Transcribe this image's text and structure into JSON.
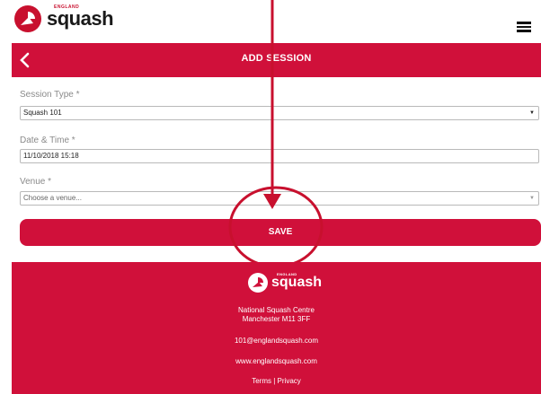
{
  "brand": {
    "small": "ENGLAND",
    "name": "squash",
    "color": "#c8102e"
  },
  "header": {
    "menu_icon": "hamburger-menu-icon",
    "back_icon": "chevron-left-icon",
    "title": "ADD SESSION"
  },
  "form": {
    "session_type": {
      "label": "Session Type *",
      "value": "Squash 101"
    },
    "date_time": {
      "label": "Date & Time *",
      "value": "11/10/2018 15:18"
    },
    "venue": {
      "label": "Venue *",
      "placeholder": "Choose a venue..."
    },
    "save_label": "SAVE"
  },
  "footer": {
    "brand_small": "ENGLAND",
    "brand_name": "squash",
    "address_line1": "National Squash Centre",
    "address_line2": "Manchester M11 3FF",
    "email": "101@englandsquash.com",
    "website": "www.englandsquash.com",
    "terms": "Terms",
    "separator": "|",
    "privacy": "Privacy"
  },
  "colors": {
    "primary": "#d0103a",
    "label": "#8a8a8a",
    "border": "#b9b9b9"
  }
}
